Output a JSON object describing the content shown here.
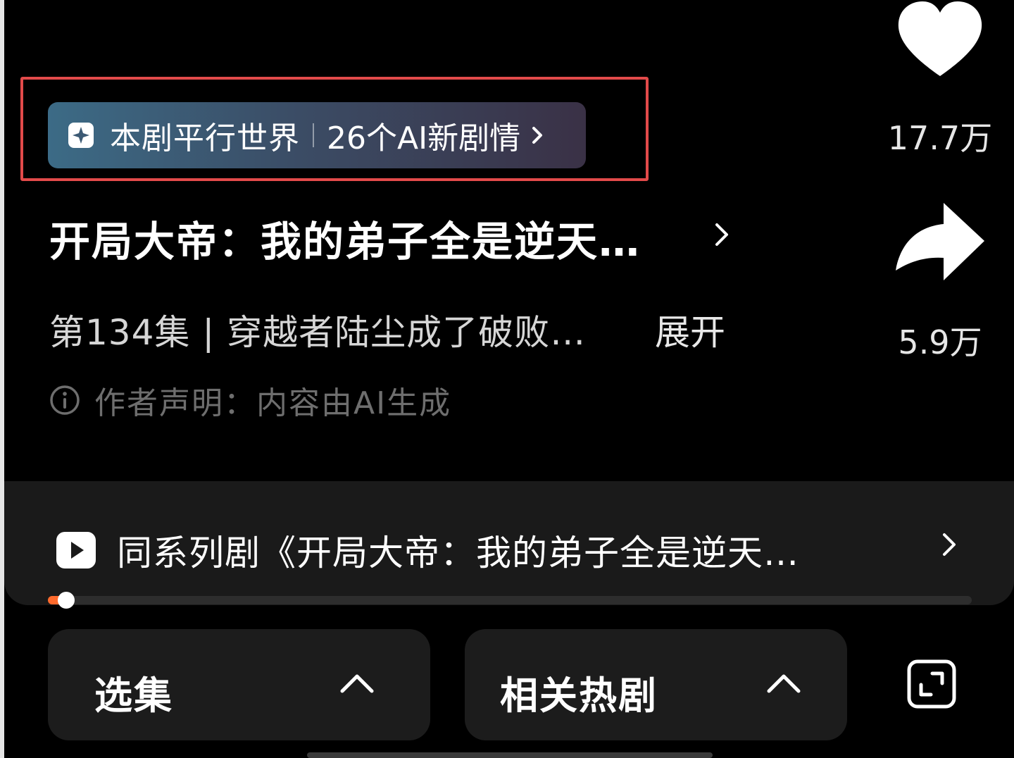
{
  "ai_banner": {
    "label": "本剧平行世界",
    "count_label": "26个AI新剧情",
    "icon": "sparkle-icon",
    "highlight_color": "#e24a4a"
  },
  "drama": {
    "title": "开局大帝：我的弟子全是逆天…",
    "episode_desc": "第134集 | 穿越者陆尘成了破败…",
    "expand_label": "展开",
    "disclaimer": "作者声明：内容由AI生成"
  },
  "actions": {
    "like_count": "17.7万",
    "share_count": "5.9万"
  },
  "series": {
    "label": "同系列剧《开局大帝：我的弟子全是逆天…",
    "progress": 0.02
  },
  "bottom": {
    "episodes_label": "选集",
    "related_label": "相关热剧"
  },
  "colors": {
    "accent": "#ff6a2c",
    "banner_start": "#3c6b86",
    "banner_end": "#3a3146"
  }
}
